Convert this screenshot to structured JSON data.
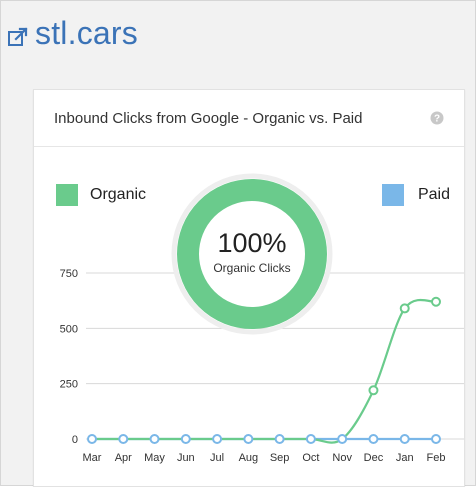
{
  "site": {
    "title": "stl.cars",
    "icon": "external-link-icon"
  },
  "card": {
    "title": "Inbound Clicks from Google - Organic vs. Paid",
    "help_icon": "help-icon"
  },
  "legend": {
    "organic_label": "Organic",
    "paid_label": "Paid"
  },
  "donut": {
    "percent_label": "100%",
    "sub_label": "Organic Clicks",
    "organic_share": 1.0
  },
  "colors": {
    "organic": "#6acb8c",
    "paid": "#7ab7e8",
    "accent": "#3b73b7"
  },
  "chart_data": {
    "type": "line",
    "categories": [
      "Mar",
      "Apr",
      "May",
      "Jun",
      "Jul",
      "Aug",
      "Sep",
      "Oct",
      "Nov",
      "Dec",
      "Jan",
      "Feb"
    ],
    "series": [
      {
        "name": "Organic",
        "values": [
          0,
          0,
          0,
          0,
          0,
          0,
          0,
          0,
          0,
          220,
          590,
          620
        ]
      },
      {
        "name": "Paid",
        "values": [
          0,
          0,
          0,
          0,
          0,
          0,
          0,
          0,
          0,
          0,
          0,
          0
        ]
      }
    ],
    "yticks": [
      0,
      250,
      500,
      750
    ],
    "ylim": [
      0,
      800
    ],
    "grid": true,
    "legend": "top"
  }
}
